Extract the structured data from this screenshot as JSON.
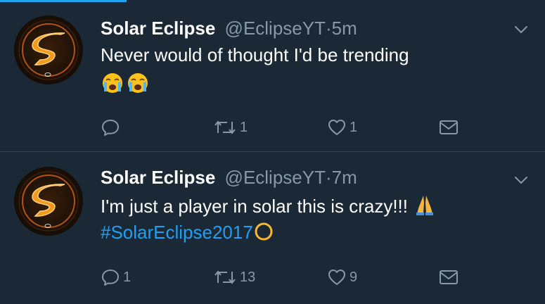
{
  "colors": {
    "background": "#1b2836",
    "accent": "#1da1f2",
    "secondary_text": "#8899a6",
    "divider": "#38444d"
  },
  "tweets": [
    {
      "name": "Solar Eclipse",
      "handle": "@EclipseYT",
      "separator": "·",
      "time": "5m",
      "text": "Never would of thought I'd be trending",
      "emojis": [
        "loudly-crying-face",
        "loudly-crying-face"
      ],
      "reply_count": "",
      "retweet_count": "1",
      "like_count": "1"
    },
    {
      "name": "Solar Eclipse",
      "handle": "@EclipseYT",
      "separator": "·",
      "time": "7m",
      "text": "I'm just a player in solar this is crazy!!!",
      "emoji_after_text": "folded-hands",
      "hashtag": "#SolarEclipse2017",
      "hashtag_emoji": "eclipse-circle",
      "reply_count": "1",
      "retweet_count": "13",
      "like_count": "9"
    }
  ]
}
